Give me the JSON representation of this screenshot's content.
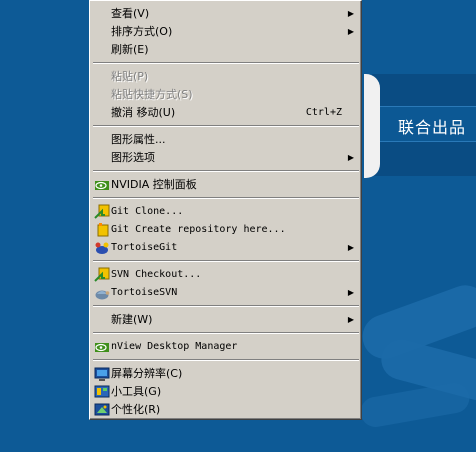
{
  "desktop": {
    "banner_text": "联合出品"
  },
  "menu": {
    "view": "查看(V)",
    "sort": "排序方式(O)",
    "refresh": "刷新(E)",
    "paste": "粘贴(P)",
    "paste_shortcut": "粘贴快捷方式(S)",
    "undo_move": "撤消 移动(U)",
    "undo_shortcut": "Ctrl+Z",
    "graphics_props": "图形属性...",
    "graphics_options": "图形选项",
    "nvidia_panel": "NVIDIA 控制面板",
    "git_clone": "Git Clone...",
    "git_create": "Git Create repository here...",
    "tortoisegit": "TortoiseGit",
    "svn_checkout": "SVN Checkout...",
    "tortoisesvn": "TortoiseSVN",
    "new": "新建(W)",
    "nview": "nView Desktop Manager",
    "resolution": "屏幕分辨率(C)",
    "gadgets": "小工具(G)",
    "personalize": "个性化(R)",
    "submenu_arrow": "▶"
  },
  "colors": {
    "desktop_bg": "#0d5a96",
    "menu_bg": "#d4d0c8",
    "disabled_text": "#808080"
  },
  "icons": {
    "nvidia": "nvidia-icon",
    "git_clone": "git-clone-icon",
    "git_create": "git-create-icon",
    "tortoisegit": "tortoisegit-icon",
    "svn_checkout": "svn-checkout-icon",
    "tortoisesvn": "tortoisesvn-icon",
    "nview": "nview-icon",
    "resolution": "display-icon",
    "gadgets": "gadgets-icon",
    "personalize": "personalize-icon"
  }
}
